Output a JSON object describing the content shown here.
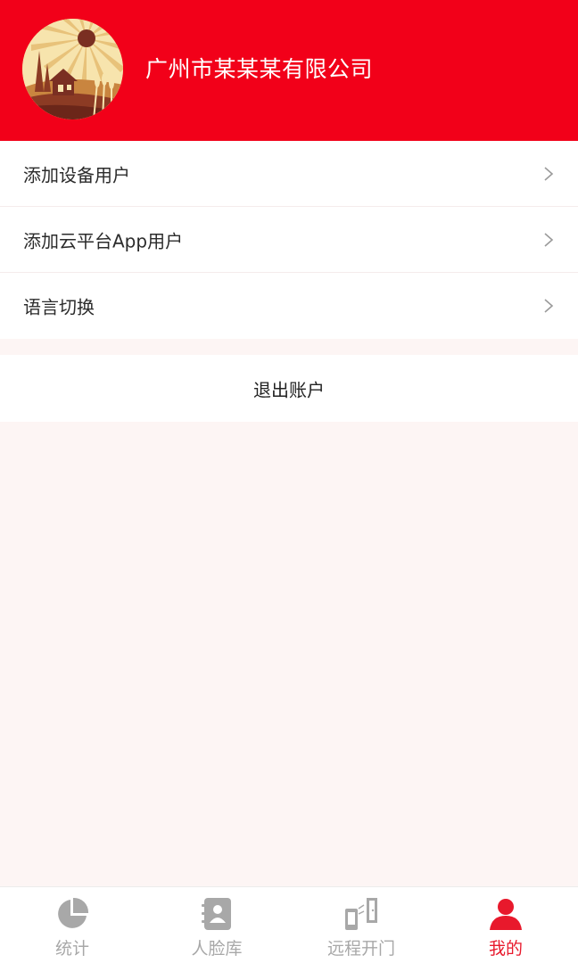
{
  "header": {
    "company_name": "广州市某某某有限公司",
    "background_color": "#f20019"
  },
  "menu": {
    "items": [
      {
        "label": "添加设备用户",
        "icon": "chevron-right-icon"
      },
      {
        "label": "添加云平台App用户",
        "icon": "chevron-right-icon"
      },
      {
        "label": "语言切换",
        "icon": "chevron-right-icon"
      }
    ]
  },
  "logout": {
    "label": "退出账户"
  },
  "tabbar": {
    "active_color": "#e8192c",
    "inactive_color": "#a8a8a8",
    "tabs": [
      {
        "label": "统计",
        "icon": "pie-chart-icon",
        "active": false
      },
      {
        "label": "人脸库",
        "icon": "contacts-book-icon",
        "active": false
      },
      {
        "label": "远程开门",
        "icon": "remote-door-icon",
        "active": false
      },
      {
        "label": "我的",
        "icon": "user-icon",
        "active": true
      }
    ]
  }
}
